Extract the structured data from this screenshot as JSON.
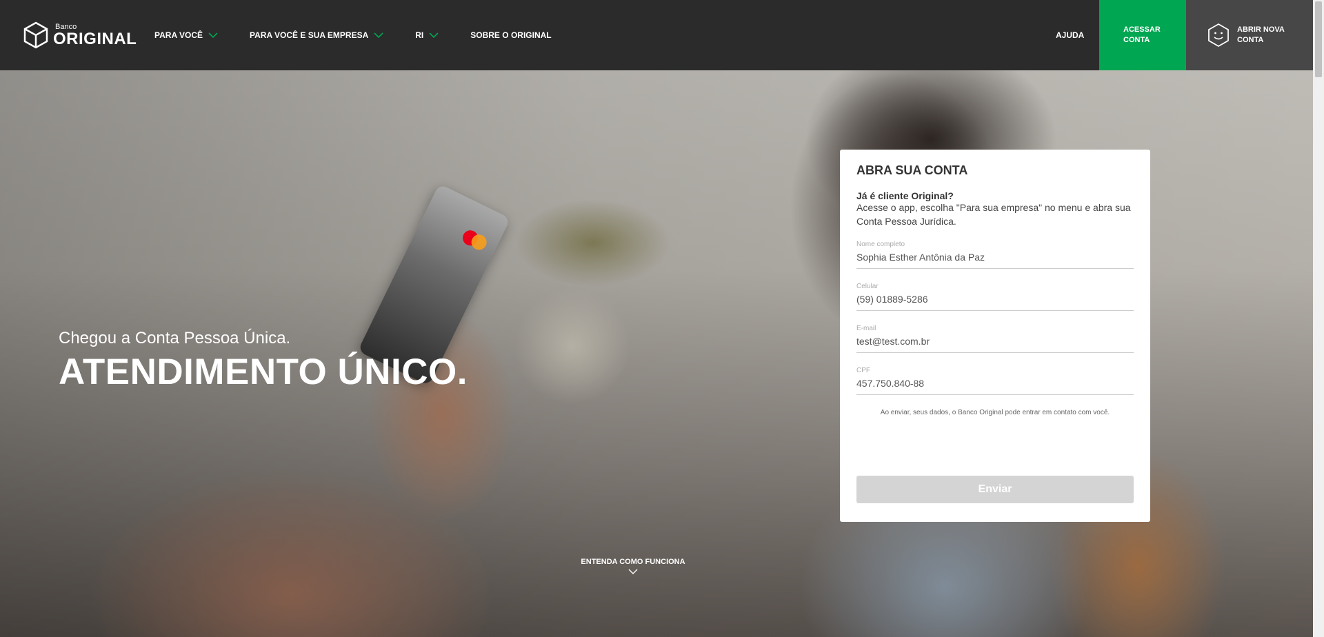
{
  "header": {
    "logo_small": "Banco",
    "logo_big": "ORIGINAL",
    "nav": [
      {
        "label": "PARA VOCÊ",
        "has_dropdown": true
      },
      {
        "label": "PARA VOCÊ E SUA EMPRESA",
        "has_dropdown": true
      },
      {
        "label": "RI",
        "has_dropdown": true
      },
      {
        "label": "SOBRE O ORIGINAL",
        "has_dropdown": false
      }
    ],
    "help": "AJUDA",
    "access_button": "ACESSAR CONTA",
    "open_button": "ABRIR NOVA CONTA"
  },
  "hero": {
    "subtitle": "Chegou a Conta Pessoa Única.",
    "title": "ATENDIMENTO ÚNICO.",
    "how_it_works": "ENTENDA COMO FUNCIONA"
  },
  "form": {
    "title": "ABRA SUA CONTA",
    "question": "Já é cliente Original?",
    "description": "Acesse o app, escolha \"Para sua empresa\" no menu e abra sua Conta Pessoa Jurídica.",
    "fields": [
      {
        "label": "Nome completo",
        "value": "Sophia Esther Antônia da Paz"
      },
      {
        "label": "Celular",
        "value": "(59) 01889-5286"
      },
      {
        "label": "E-mail",
        "value": "test@test.com.br"
      },
      {
        "label": "CPF",
        "value": "457.750.840-88"
      }
    ],
    "consent": "Ao enviar, seus dados, o Banco Original pode entrar em contato com você.",
    "submit": "Enviar"
  },
  "colors": {
    "header_bg": "#2b2b2b",
    "brand_green": "#00a651",
    "open_account_bg": "#474747",
    "submit_disabled": "#d4d4d4"
  }
}
